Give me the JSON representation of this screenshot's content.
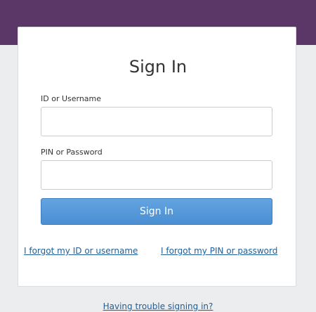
{
  "header": {
    "color": "#5b3768"
  },
  "form": {
    "title": "Sign In",
    "id_label": "ID or Username",
    "id_value": "",
    "pin_label": "PIN or Password",
    "pin_value": "",
    "submit_label": "Sign In",
    "submit_color": "#4b8fd3"
  },
  "links": {
    "forgot_id": "I forgot my ID or username",
    "forgot_pin": "I forgot my PIN or password",
    "trouble": "Having trouble signing in?",
    "color": "#1f5e96"
  }
}
